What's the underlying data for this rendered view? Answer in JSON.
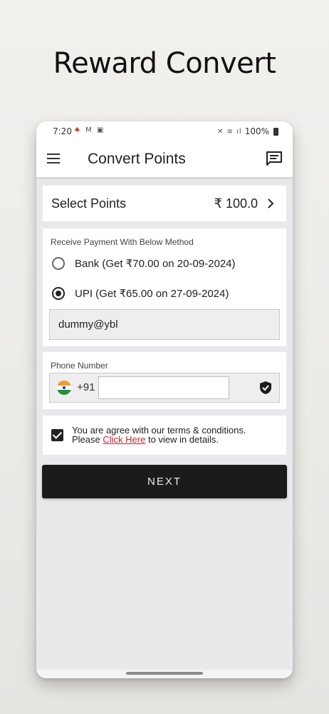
{
  "promo": {
    "title": "Reward Convert"
  },
  "status_bar": {
    "time": "7:20",
    "battery": "100%"
  },
  "app_bar": {
    "title": "Convert Points"
  },
  "select_points": {
    "label": "Select Points",
    "value": "₹ 100.0"
  },
  "payment": {
    "heading": "Receive Payment With Below Method",
    "options": [
      {
        "label": "Bank (Get ₹70.00 on 20-09-2024)",
        "selected": false
      },
      {
        "label": "UPI (Get ₹65.00 on 27-09-2024)",
        "selected": true
      }
    ],
    "upi_id": "dummy@ybl"
  },
  "phone": {
    "label": "Phone Number",
    "dial_code": "+91",
    "number": ""
  },
  "terms": {
    "line1": "You are agree with our terms & conditions.",
    "prefix": "Please ",
    "link": "Click Here",
    "suffix": " to view in details.",
    "checked": true
  },
  "next_label": "NEXT",
  "icons": {
    "menu": "menu-icon",
    "chat": "chat-icon",
    "chevron": "chevron-right-icon",
    "flag": "india-flag-icon",
    "shield": "shield-check-icon"
  },
  "colors": {
    "button": "#1b1b1b",
    "link": "#c0272d"
  }
}
